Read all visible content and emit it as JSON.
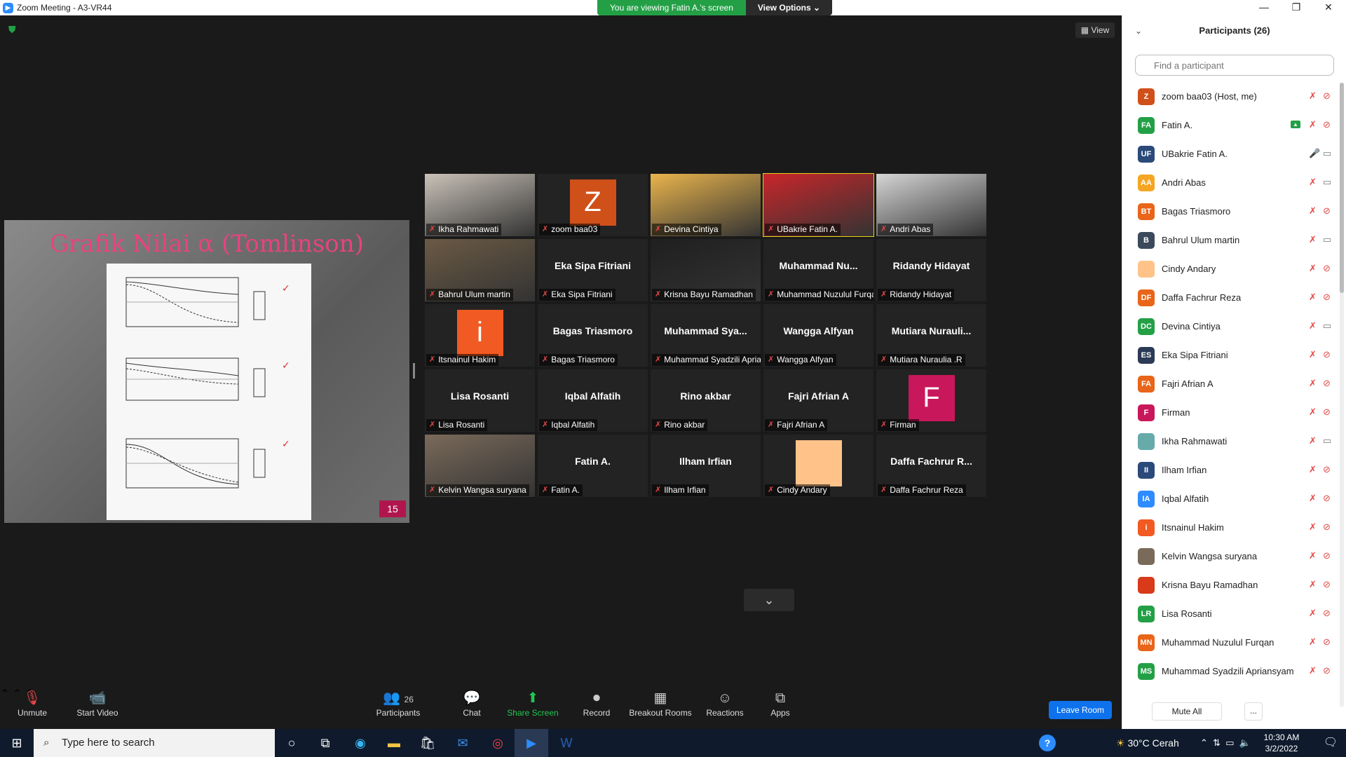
{
  "window": {
    "title": "Zoom Meeting - A3-VR44",
    "app_icon": "zoom-icon"
  },
  "banner": {
    "viewing": "You are viewing Fatin A.'s screen",
    "view_options": "View Options"
  },
  "view_button": "View",
  "shared_slide": {
    "title": "Grafik Nilai α (Tomlinson)",
    "page_number": "15"
  },
  "tiles": [
    {
      "label": "Ikha Rahmawati",
      "type": "photo",
      "color": "#c9c2b8"
    },
    {
      "label": "zoom baa03",
      "type": "avatar",
      "letter": "Z",
      "color": "#d0501a"
    },
    {
      "label": "Devina Cintiya",
      "type": "photo",
      "color": "#e9b44c"
    },
    {
      "label": "UBakrie Fatin A.",
      "type": "photo",
      "color": "#c8262a"
    },
    {
      "label": "Andri Abas",
      "type": "photo",
      "color": "#d5d5d5"
    },
    {
      "label": "Bahrul Ulum martin",
      "type": "photo",
      "color": "#6b5a44"
    },
    {
      "label": "Eka Sipa Fitriani",
      "type": "name",
      "name": "Eka Sipa Fitriani"
    },
    {
      "label": "Krisna Bayu Ramadhan",
      "type": "photo",
      "color": "#1f1f1f"
    },
    {
      "label": "Muhammad Nuzulul Furqan",
      "type": "name",
      "name": "Muhammad  Nu..."
    },
    {
      "label": "Ridandy Hidayat",
      "type": "name",
      "name": "Ridandy Hidayat"
    },
    {
      "label": "Itsnainul Hakim",
      "type": "avatar",
      "letter": "i",
      "color": "#f15a22"
    },
    {
      "label": "Bagas Triasmoro",
      "type": "name",
      "name": "Bagas Triasmoro"
    },
    {
      "label": "Muhammad Syadzili Apria...",
      "type": "name",
      "name": "Muhammad  Sya..."
    },
    {
      "label": "Wangga Alfyan",
      "type": "name",
      "name": "Wangga Alfyan"
    },
    {
      "label": "Mutiara Nuraulia .R",
      "type": "name",
      "name": "Mutiara  Nurauli..."
    },
    {
      "label": "Lisa Rosanti",
      "type": "name",
      "name": "Lisa Rosanti"
    },
    {
      "label": "Iqbal Alfatih",
      "type": "name",
      "name": "Iqbal Alfatih"
    },
    {
      "label": "Rino akbar",
      "type": "name",
      "name": "Rino akbar"
    },
    {
      "label": "Fajri Afrian A",
      "type": "name",
      "name": "Fajri Afrian A"
    },
    {
      "label": "Firman",
      "type": "avatar",
      "letter": "F",
      "color": "#c8185b"
    },
    {
      "label": "Kelvin Wangsa suryana",
      "type": "photo",
      "color": "#7a6a5a"
    },
    {
      "label": "Fatin A.",
      "type": "name",
      "name": "Fatin A."
    },
    {
      "label": "Ilham Irfian",
      "type": "name",
      "name": "Ilham Irfian"
    },
    {
      "label": "Cindy Andary",
      "type": "avatar",
      "letter": "",
      "color": "#ffc38a"
    },
    {
      "label": "Daffa Fachrur Reza",
      "type": "name",
      "name": "Daffa Fachrur R..."
    }
  ],
  "active_tile_index": 3,
  "toolbar": {
    "unmute": "Unmute",
    "start_video": "Start Video",
    "participants": "Participants",
    "participants_count": "26",
    "chat": "Chat",
    "share_screen": "Share Screen",
    "record": "Record",
    "breakout": "Breakout Rooms",
    "reactions": "Reactions",
    "apps": "Apps",
    "leave": "Leave Room"
  },
  "panel": {
    "title": "Participants (26)",
    "search_placeholder": "Find a participant",
    "mute_all": "Mute All",
    "more": "...",
    "participants": [
      {
        "initials": "Z",
        "name": "zoom baa03 (Host, me)",
        "color": "#d0501a",
        "mic": "off",
        "cam": "off"
      },
      {
        "initials": "FA",
        "name": "Fatin A.",
        "color": "#23a046",
        "mic": "off",
        "cam": "off",
        "sharing": true
      },
      {
        "initials": "UF",
        "name": "UBakrie Fatin A.",
        "color": "#2b4a7a",
        "mic": "on",
        "cam": "on"
      },
      {
        "initials": "AA",
        "name": "Andri Abas",
        "color": "#f4a623",
        "mic": "off",
        "cam": "on"
      },
      {
        "initials": "BT",
        "name": "Bagas Triasmoro",
        "color": "#e8651a",
        "mic": "off",
        "cam": "off"
      },
      {
        "initials": "B",
        "name": "Bahrul Ulum martin",
        "color": "#3a4a5a",
        "mic": "off",
        "cam": "on"
      },
      {
        "initials": "",
        "name": "Cindy Andary",
        "color": "#ffc38a",
        "mic": "off",
        "cam": "off"
      },
      {
        "initials": "DF",
        "name": "Daffa Fachrur Reza",
        "color": "#e8651a",
        "mic": "off",
        "cam": "off"
      },
      {
        "initials": "DC",
        "name": "Devina Cintiya",
        "color": "#23a046",
        "mic": "off",
        "cam": "on"
      },
      {
        "initials": "ES",
        "name": "Eka Sipa Fitriani",
        "color": "#2b3a55",
        "mic": "off",
        "cam": "off"
      },
      {
        "initials": "FA",
        "name": "Fajri Afrian A",
        "color": "#e8651a",
        "mic": "off",
        "cam": "off"
      },
      {
        "initials": "F",
        "name": "Firman",
        "color": "#c8185b",
        "mic": "off",
        "cam": "off"
      },
      {
        "initials": "",
        "name": "Ikha Rahmawati",
        "color": "#6aa",
        "mic": "off",
        "cam": "on"
      },
      {
        "initials": "II",
        "name": "Ilham Irfian",
        "color": "#2b4a7a",
        "mic": "off",
        "cam": "off"
      },
      {
        "initials": "IA",
        "name": "Iqbal Alfatih",
        "color": "#2d8cff",
        "mic": "off",
        "cam": "off"
      },
      {
        "initials": "i",
        "name": "Itsnainul Hakim",
        "color": "#f15a22",
        "mic": "off",
        "cam": "off"
      },
      {
        "initials": "",
        "name": "Kelvin Wangsa suryana",
        "color": "#7a6a5a",
        "mic": "off",
        "cam": "off"
      },
      {
        "initials": "",
        "name": "Krisna Bayu Ramadhan",
        "color": "#d83a1a",
        "mic": "off",
        "cam": "off"
      },
      {
        "initials": "LR",
        "name": "Lisa Rosanti",
        "color": "#23a046",
        "mic": "off",
        "cam": "off"
      },
      {
        "initials": "MN",
        "name": "Muhammad Nuzulul Furqan",
        "color": "#e8651a",
        "mic": "off",
        "cam": "off"
      },
      {
        "initials": "MS",
        "name": "Muhammad Syadzili Apriansyam",
        "color": "#23a046",
        "mic": "off",
        "cam": "off"
      }
    ]
  },
  "taskbar": {
    "search_placeholder": "Type here to search",
    "weather": "30°C  Cerah",
    "time": "10:30 AM",
    "date": "3/2/2022"
  }
}
